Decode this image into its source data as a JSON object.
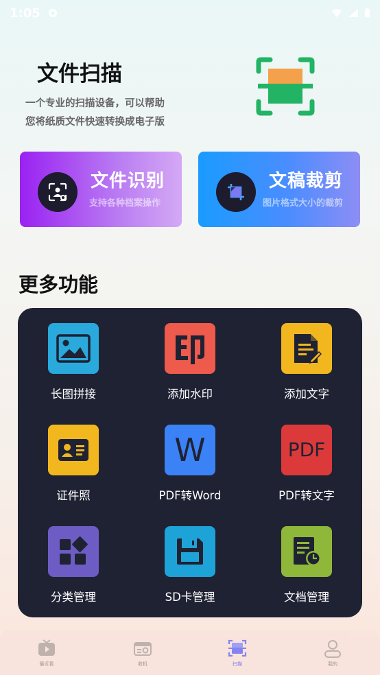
{
  "status_bar": {
    "time": "1:05",
    "notification_icon": "app-notification-icon",
    "right_icons": [
      "wifi-icon",
      "signal-icon",
      "battery-icon"
    ]
  },
  "hero": {
    "title": "文件扫描",
    "desc_line1": "一个专业的扫描设备，可以帮助",
    "desc_line2": "您将纸质文件快速转换成电子版",
    "icon": "document-scan-icon"
  },
  "cards": [
    {
      "title": "文件识别",
      "subtitle": "支持各种档案操作",
      "icon": "scan-recognize-icon"
    },
    {
      "title": "文稿裁剪",
      "subtitle": "图片格式大小的裁剪",
      "icon": "crop-icon"
    }
  ],
  "more": {
    "title": "更多功能",
    "items": [
      {
        "label": "长图拼接",
        "icon": "image-icon",
        "color": "#29a9dc"
      },
      {
        "label": "添加水印",
        "icon": "watermark-icon",
        "color": "#ee5a4c"
      },
      {
        "label": "添加文字",
        "icon": "add-text-icon",
        "color": "#f2b71f"
      },
      {
        "label": "证件照",
        "icon": "id-card-icon",
        "color": "#f2b71f"
      },
      {
        "label": "PDF转Word",
        "icon": "word-icon",
        "color": "#3b82f6",
        "glyph": "W"
      },
      {
        "label": "PDF转文字",
        "icon": "pdf-icon",
        "color": "#dc3a3a",
        "glyph": "PDF"
      },
      {
        "label": "分类管理",
        "icon": "category-icon",
        "color": "#6d5cc4"
      },
      {
        "label": "SD卡管理",
        "icon": "save-icon",
        "color": "#1ea3d9"
      },
      {
        "label": "文档管理",
        "icon": "document-clock-icon",
        "color": "#8fb83a"
      }
    ]
  },
  "bottom_nav": {
    "items": [
      {
        "label": "最近看",
        "icon": "tv-icon",
        "active": false
      },
      {
        "label": "收机",
        "icon": "radio-icon",
        "active": false
      },
      {
        "label": "扫描",
        "icon": "scan-icon",
        "active": true
      },
      {
        "label": "我的",
        "icon": "user-icon",
        "active": false
      }
    ]
  },
  "colors": {
    "accent": "#7b7cf2",
    "panel": "#1f2233",
    "green": "#22b464",
    "orange": "#f5a04a"
  }
}
